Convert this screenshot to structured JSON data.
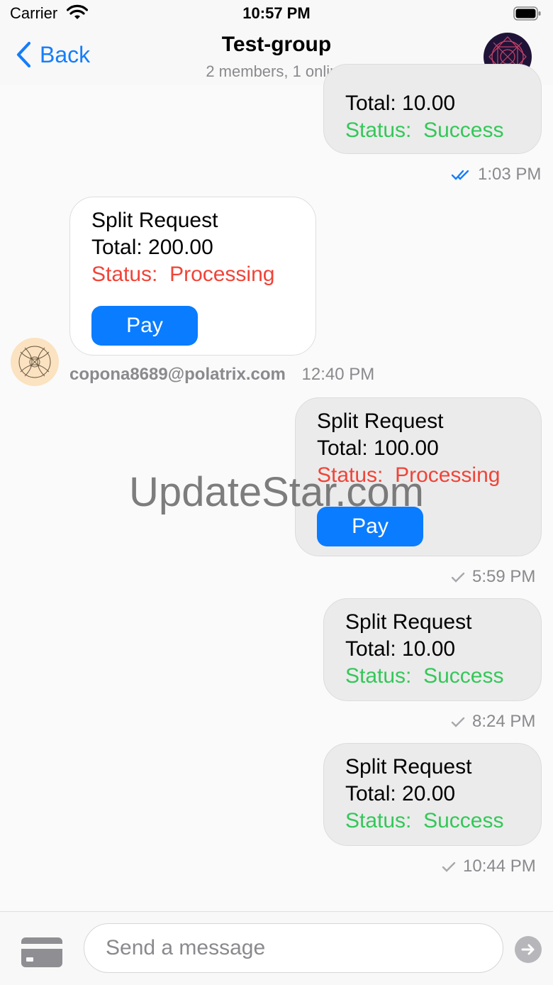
{
  "status_bar": {
    "carrier": "Carrier",
    "time": "10:57 PM"
  },
  "nav": {
    "back_label": "Back",
    "title": "Test-group",
    "subtitle": "2 members, 1 online"
  },
  "messages": [
    {
      "direction": "out",
      "title": "",
      "total": "Total: 10.00",
      "status_label": "Status:",
      "status_value": "Success",
      "time": "1:03 PM",
      "read": true
    },
    {
      "direction": "in",
      "title": "Split Request",
      "total": "Total: 200.00",
      "status_label": "Status:",
      "status_value": "Processing",
      "pay_label": "Pay",
      "sender": "copona8689@polatrix.com",
      "time": "12:40 PM"
    },
    {
      "direction": "out",
      "title": "Split Request",
      "total": "Total: 100.00",
      "status_label": "Status:",
      "status_value": "Processing",
      "pay_label": "Pay",
      "time": "5:59 PM",
      "read": false
    },
    {
      "direction": "out",
      "title": "Split Request",
      "total": "Total: 10.00",
      "status_label": "Status:",
      "status_value": "Success",
      "time": "8:24 PM",
      "read": false
    },
    {
      "direction": "out",
      "title": "Split Request",
      "total": "Total: 20.00",
      "status_label": "Status:",
      "status_value": "Success",
      "time": "10:44 PM",
      "read": false
    }
  ],
  "watermark": "UpdateStar.com",
  "composer": {
    "placeholder": "Send a message"
  },
  "colors": {
    "accent": "#0a7cff",
    "success": "#34c759",
    "processing": "#f04438",
    "muted": "#8a8a8e"
  },
  "icons": {
    "back": "chevron-left-icon",
    "card": "credit-card-icon",
    "send": "send-arrow-icon",
    "read_receipt": "double-check-icon",
    "sent_receipt": "check-icon"
  }
}
